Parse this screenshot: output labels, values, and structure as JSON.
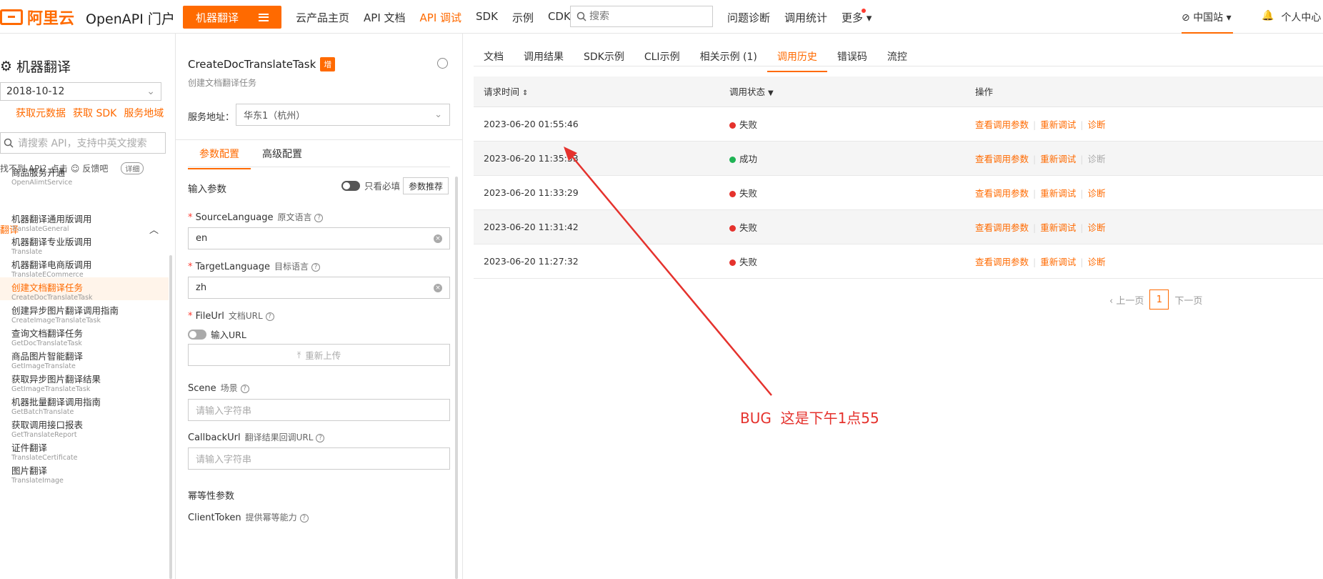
{
  "topbar": {
    "logo_text": "阿里云",
    "portal_title": "OpenAPI 门户",
    "product_button": "机器翻译",
    "nav": [
      "云产品主页",
      "API 文档",
      "API 调试",
      "SDK",
      "示例",
      "CDK"
    ],
    "active_nav_index": 2,
    "search_placeholder": "搜索",
    "right_nav": [
      "问题诊断",
      "调用统计",
      "更多"
    ],
    "site": "中国站",
    "user": "个人中心"
  },
  "sidebar": {
    "title": "机器翻译",
    "version": "2018-10-12",
    "links": [
      "获取元数据",
      "获取 SDK",
      "服务地域"
    ],
    "search_placeholder": "请搜索 API，支持中英文搜索",
    "feedback_text": "找不到 API？点击",
    "feedback_link": "反馈吧",
    "detail_label": "详细",
    "service_item": {
      "cn": "商品服务开通",
      "en": "OpenAlimtService"
    },
    "group_title": "翻译",
    "items": [
      {
        "cn": "机器翻译通用版调用",
        "en": "TranslateGeneral"
      },
      {
        "cn": "机器翻译专业版调用",
        "en": "Translate"
      },
      {
        "cn": "机器翻译电商版调用",
        "en": "TranslateECommerce"
      },
      {
        "cn": "创建文档翻译任务",
        "en": "CreateDocTranslateTask"
      },
      {
        "cn": "创建异步图片翻译调用指南",
        "en": "CreateImageTranslateTask"
      },
      {
        "cn": "查询文档翻译任务",
        "en": "GetDocTranslateTask"
      },
      {
        "cn": "商品图片智能翻译",
        "en": "GetImageTranslate"
      },
      {
        "cn": "获取异步图片翻译结果",
        "en": "GetImageTranslateTask"
      },
      {
        "cn": "机器批量翻译调用指南",
        "en": "GetBatchTranslate"
      },
      {
        "cn": "获取调用接口报表",
        "en": "GetTranslateReport"
      },
      {
        "cn": "证件翻译",
        "en": "TranslateCertificate"
      },
      {
        "cn": "图片翻译",
        "en": "TranslateImage"
      }
    ],
    "active_index": 3
  },
  "middle": {
    "api_name": "CreateDocTranslateTask",
    "tag": "增",
    "api_desc": "创建文档翻译任务",
    "service_label": "服务地址：",
    "service_value": "华东1（杭州）",
    "tabs": [
      "参数配置",
      "高级配置"
    ],
    "input_params_label": "输入参数",
    "required_only_label": "只看必填",
    "recommend_button": "参数推荐",
    "params": {
      "source": {
        "name": "SourceLanguage",
        "cn": "原文语言",
        "value": "en"
      },
      "target": {
        "name": "TargetLanguage",
        "cn": "目标语言",
        "value": "zh"
      },
      "fileurl": {
        "name": "FileUrl",
        "cn": "文档URL"
      },
      "scene": {
        "name": "Scene",
        "cn": "场景",
        "placeholder": "请输入字符串"
      },
      "callback": {
        "name": "CallbackUrl",
        "cn": "翻译结果回调URL",
        "placeholder": "请输入字符串"
      },
      "clienttoken": {
        "name": "ClientToken",
        "cn": "提供幂等能力"
      }
    },
    "url_toggle_label": "输入URL",
    "reupload_label": "重新上传",
    "idempotent_title": "幂等性参数"
  },
  "right": {
    "tabs": [
      "文档",
      "调用结果",
      "SDK示例",
      "CLI示例",
      "相关示例 (1)",
      "调用历史",
      "错误码",
      "流控"
    ],
    "active_tab_index": 5,
    "columns": [
      "请求时间",
      "调用状态",
      "操作"
    ],
    "rows": [
      {
        "time": "2023-06-20 01:55:46",
        "status": "失败",
        "ok": false
      },
      {
        "time": "2023-06-20 11:35:53",
        "status": "成功",
        "ok": true
      },
      {
        "time": "2023-06-20 11:33:29",
        "status": "失败",
        "ok": false
      },
      {
        "time": "2023-06-20 11:31:42",
        "status": "失败",
        "ok": false
      },
      {
        "time": "2023-06-20 11:27:32",
        "status": "失败",
        "ok": false
      }
    ],
    "ops": [
      "查看调用参数",
      "重新调试",
      "诊断"
    ],
    "pager": {
      "prev": "上一页",
      "current": "1",
      "next": "下一页"
    }
  },
  "annotation": {
    "text": "BUG  这是下午1点55",
    "color": "#e5322d"
  },
  "colors": {
    "accent": "#ff6a00",
    "fail": "#e5322d",
    "success": "#1fb354"
  }
}
